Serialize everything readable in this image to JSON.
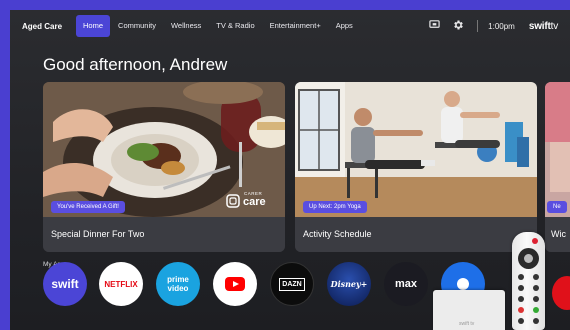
{
  "topbar": {
    "brand": "Aged Care",
    "nav": [
      "Home",
      "Community",
      "Wellness",
      "TV & Radio",
      "Entertainment+",
      "Apps"
    ],
    "active_index": 0,
    "time": "1:00pm",
    "logo": "swift tv",
    "icons": [
      "cast-icon",
      "gear-icon"
    ]
  },
  "greeting": "Good afternoon, Andrew",
  "cards": [
    {
      "tag": "You've Received A Gift!",
      "title": "Special Dinner For Two",
      "badge_top": "CARER",
      "badge_bottom": "care"
    },
    {
      "tag": "Up Next: 2pm Yoga",
      "title": "Activity Schedule"
    },
    {
      "tag": "Ne",
      "title": "Wic"
    }
  ],
  "my_apps": {
    "label": "My Apps",
    "apps": [
      {
        "name": "swift",
        "bg": "#4b45d6",
        "fg": "#ffffff"
      },
      {
        "name": "NETFLIX",
        "bg": "#ffffff",
        "fg": "#e50914"
      },
      {
        "name": "prime video",
        "bg": "#1aa3e0",
        "fg": "#ffffff"
      },
      {
        "name": "YouTube",
        "bg": "#ffffff",
        "fg": "#ff0000"
      },
      {
        "name": "DAZN",
        "bg": "#0c0c0c",
        "fg": "#ffffff"
      },
      {
        "name": "Disney+",
        "bg": "#0f2a6e",
        "fg": "#ffffff"
      },
      {
        "name": "max",
        "bg": "#1b1b22",
        "fg": "#ffffff"
      },
      {
        "name": "app",
        "bg": "#1e6fe8",
        "fg": "#ffffff"
      }
    ]
  },
  "device": {
    "label": "swift tv"
  }
}
